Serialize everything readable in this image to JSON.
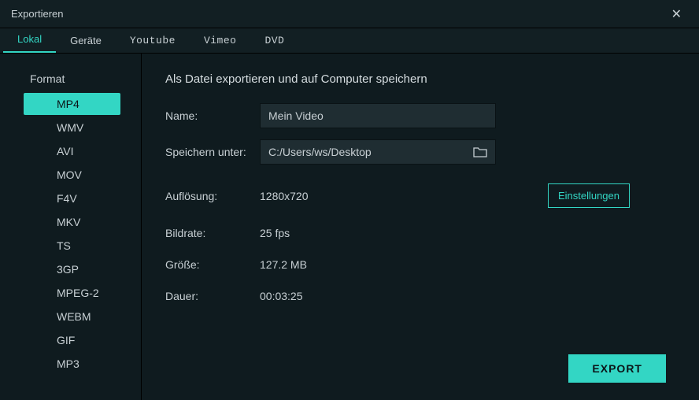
{
  "window": {
    "title": "Exportieren"
  },
  "tabs": [
    {
      "label": "Lokal",
      "active": true
    },
    {
      "label": "Geräte",
      "active": false
    },
    {
      "label": "Youtube",
      "active": false
    },
    {
      "label": "Vimeo",
      "active": false
    },
    {
      "label": "DVD",
      "active": false
    }
  ],
  "sidebar": {
    "title": "Format",
    "formats": [
      "MP4",
      "WMV",
      "AVI",
      "MOV",
      "F4V",
      "MKV",
      "TS",
      "3GP",
      "MPEG-2",
      "WEBM",
      "GIF",
      "MP3"
    ],
    "active_index": 0
  },
  "main": {
    "heading": "Als Datei exportieren und auf Computer speichern",
    "name_label": "Name:",
    "name_value": "Mein Video",
    "save_label": "Speichern unter:",
    "save_path": "C:/Users/ws/Desktop",
    "resolution_label": "Auflösung:",
    "resolution_value": "1280x720",
    "settings_button": "Einstellungen",
    "framerate_label": "Bildrate:",
    "framerate_value": "25 fps",
    "size_label": "Größe:",
    "size_value": "127.2 MB",
    "duration_label": "Dauer:",
    "duration_value": "00:03:25",
    "export_button": "EXPORT"
  }
}
